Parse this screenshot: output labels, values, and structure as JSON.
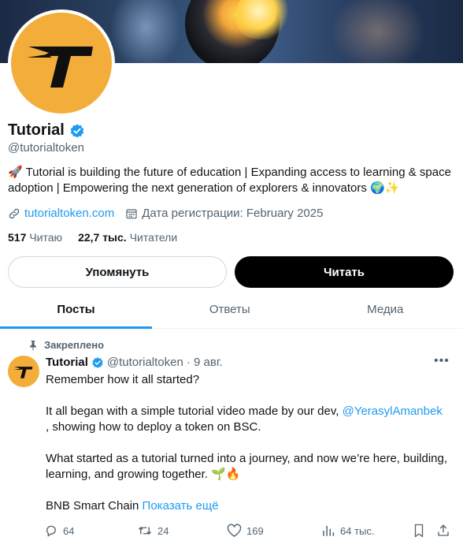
{
  "profile": {
    "name": "Tutorial",
    "handle": "@tutorialtoken",
    "bio": "🚀 Tutorial is building the future of education | Expanding access to learning & space adoption | Empowering the next generation of explorers & innovators 🌍✨",
    "website": "tutorialtoken.com",
    "joined": "Дата регистрации: February 2025",
    "following_count": "517",
    "following_label": "Читаю",
    "followers_count": "22,7 тыс.",
    "followers_label": "Читатели"
  },
  "buttons": {
    "mention": "Упомянуть",
    "follow": "Читать"
  },
  "tabs": [
    {
      "label": "Посты",
      "active": true
    },
    {
      "label": "Ответы",
      "active": false
    },
    {
      "label": "Медиа",
      "active": false
    }
  ],
  "tweet": {
    "pinned_label": "Закреплено",
    "author_name": "Tutorial",
    "author_handle": "@tutorialtoken",
    "date": "· 9 авг.",
    "line1": "Remember how it all started?",
    "line2_pre": "It all began with a simple tutorial video made by our dev, ",
    "line2_mention": "@YerasylAmanbek",
    "line2_post": ", showing how to deploy a token on BSC.",
    "line3": "What started as a tutorial turned into a journey, and now we’re here, building, learning, and growing together. 🌱🔥",
    "line4": "BNB Smart Chain",
    "show_more": "Показать ещё",
    "replies": "64",
    "retweets": "24",
    "likes": "169",
    "views": "64 тыс."
  },
  "colors": {
    "accent": "#1d9bf0",
    "avatar_bg": "#f3ad3a",
    "follow_button": "#000000"
  },
  "icons": [
    "verified-badge-icon",
    "link-icon",
    "calendar-icon",
    "pin-icon",
    "more-icon",
    "reply-icon",
    "retweet-icon",
    "like-icon",
    "views-icon",
    "bookmark-icon",
    "share-icon"
  ]
}
